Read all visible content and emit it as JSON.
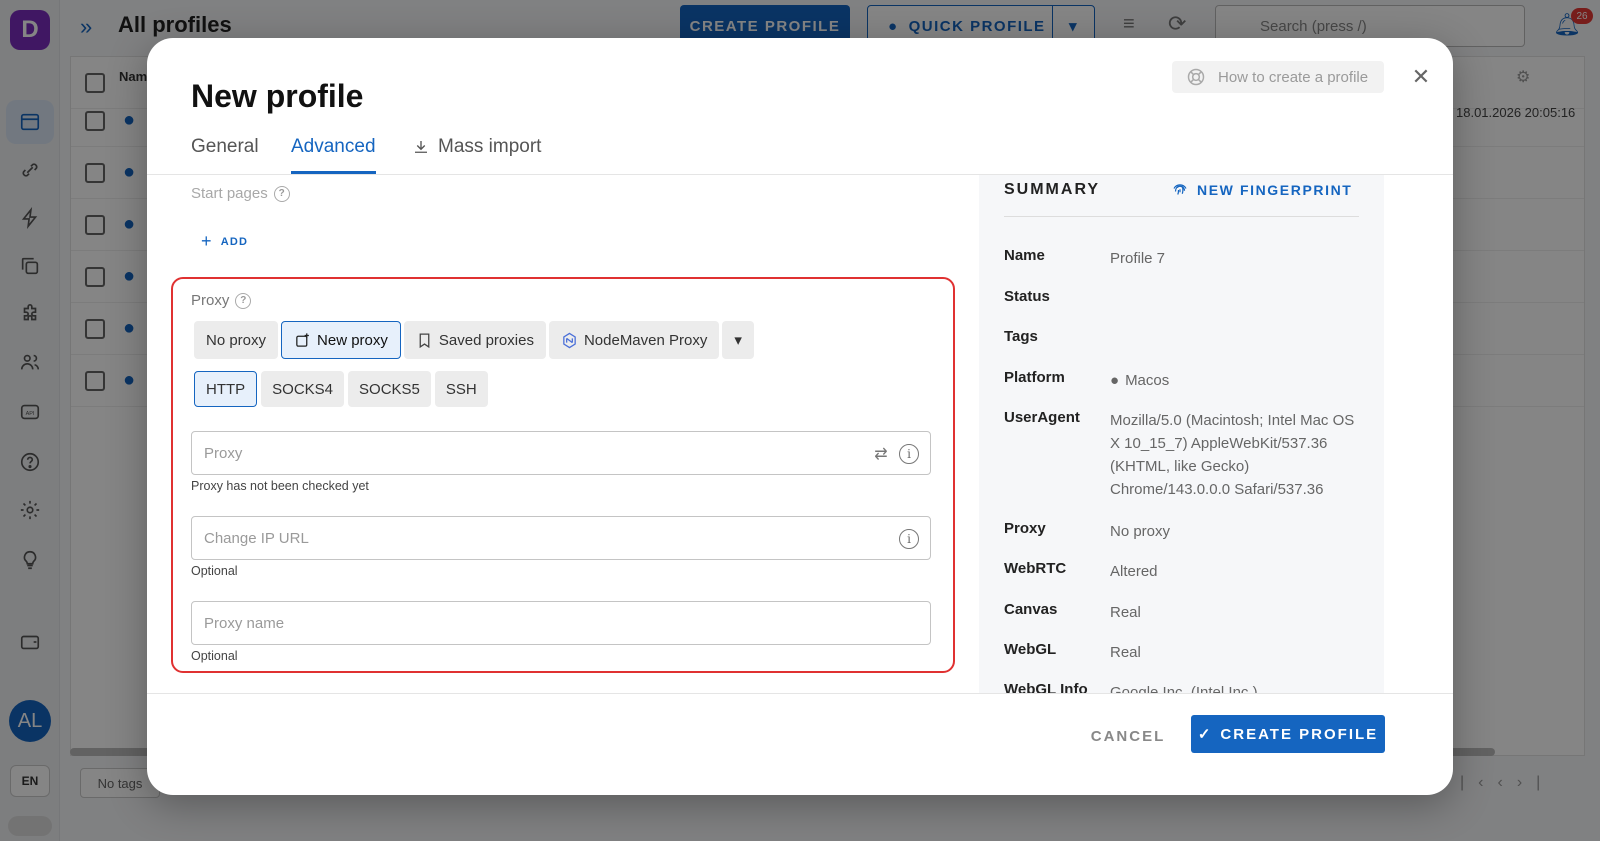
{
  "background": {
    "logo_letter": "D",
    "page_title": "All profiles",
    "create_profile_label": "CREATE PROFILE",
    "quick_profile_label": "QUICK PROFILE",
    "search_placeholder": "Search (press /)",
    "notification_count": "26",
    "table_name_header": "Nam",
    "last_date": "18.01.2026 20:05:16",
    "no_tags_label": "No tags",
    "avatar_initials": "AL",
    "language": "EN"
  },
  "dialog": {
    "title": "New profile",
    "how_to_label": "How to create a profile",
    "tabs": [
      {
        "label": "General"
      },
      {
        "label": "Advanced"
      },
      {
        "label": "Mass import"
      }
    ],
    "start_pages_label": "Start pages",
    "add_label": "ADD",
    "proxy": {
      "label": "Proxy",
      "modes": [
        "No proxy",
        "New proxy",
        "Saved proxies",
        "NodeMaven Proxy"
      ],
      "selected_mode": "New proxy",
      "types": [
        "HTTP",
        "SOCKS4",
        "SOCKS5",
        "SSH"
      ],
      "selected_type": "HTTP",
      "proxy_placeholder": "Proxy",
      "proxy_helper": "Proxy has not been checked yet",
      "change_ip_placeholder": "Change IP URL",
      "change_ip_helper": "Optional",
      "proxy_name_placeholder": "Proxy name",
      "proxy_name_helper": "Optional"
    },
    "summary": {
      "title": "SUMMARY",
      "new_fingerprint_label": "NEW FINGERPRINT",
      "rows": [
        {
          "key": "Name",
          "value": "Profile 7"
        },
        {
          "key": "Status",
          "value": ""
        },
        {
          "key": "Tags",
          "value": ""
        },
        {
          "key": "Platform",
          "value": "Macos"
        },
        {
          "key": "UserAgent",
          "value": "Mozilla/5.0 (Macintosh; Intel Mac OS X 10_15_7) AppleWebKit/537.36 (KHTML, like Gecko) Chrome/143.0.0.0 Safari/537.36"
        },
        {
          "key": "Proxy",
          "value": "No proxy"
        },
        {
          "key": "WebRTC",
          "value": "Altered"
        },
        {
          "key": "Canvas",
          "value": "Real"
        },
        {
          "key": "WebGL",
          "value": "Real"
        },
        {
          "key": "WebGL Info",
          "value": "Google Inc. (Intel Inc.)"
        }
      ]
    },
    "cancel_label": "CANCEL",
    "create_label": "CREATE PROFILE"
  },
  "colors": {
    "accent": "#1565c0",
    "highlight_border": "#e03131"
  }
}
